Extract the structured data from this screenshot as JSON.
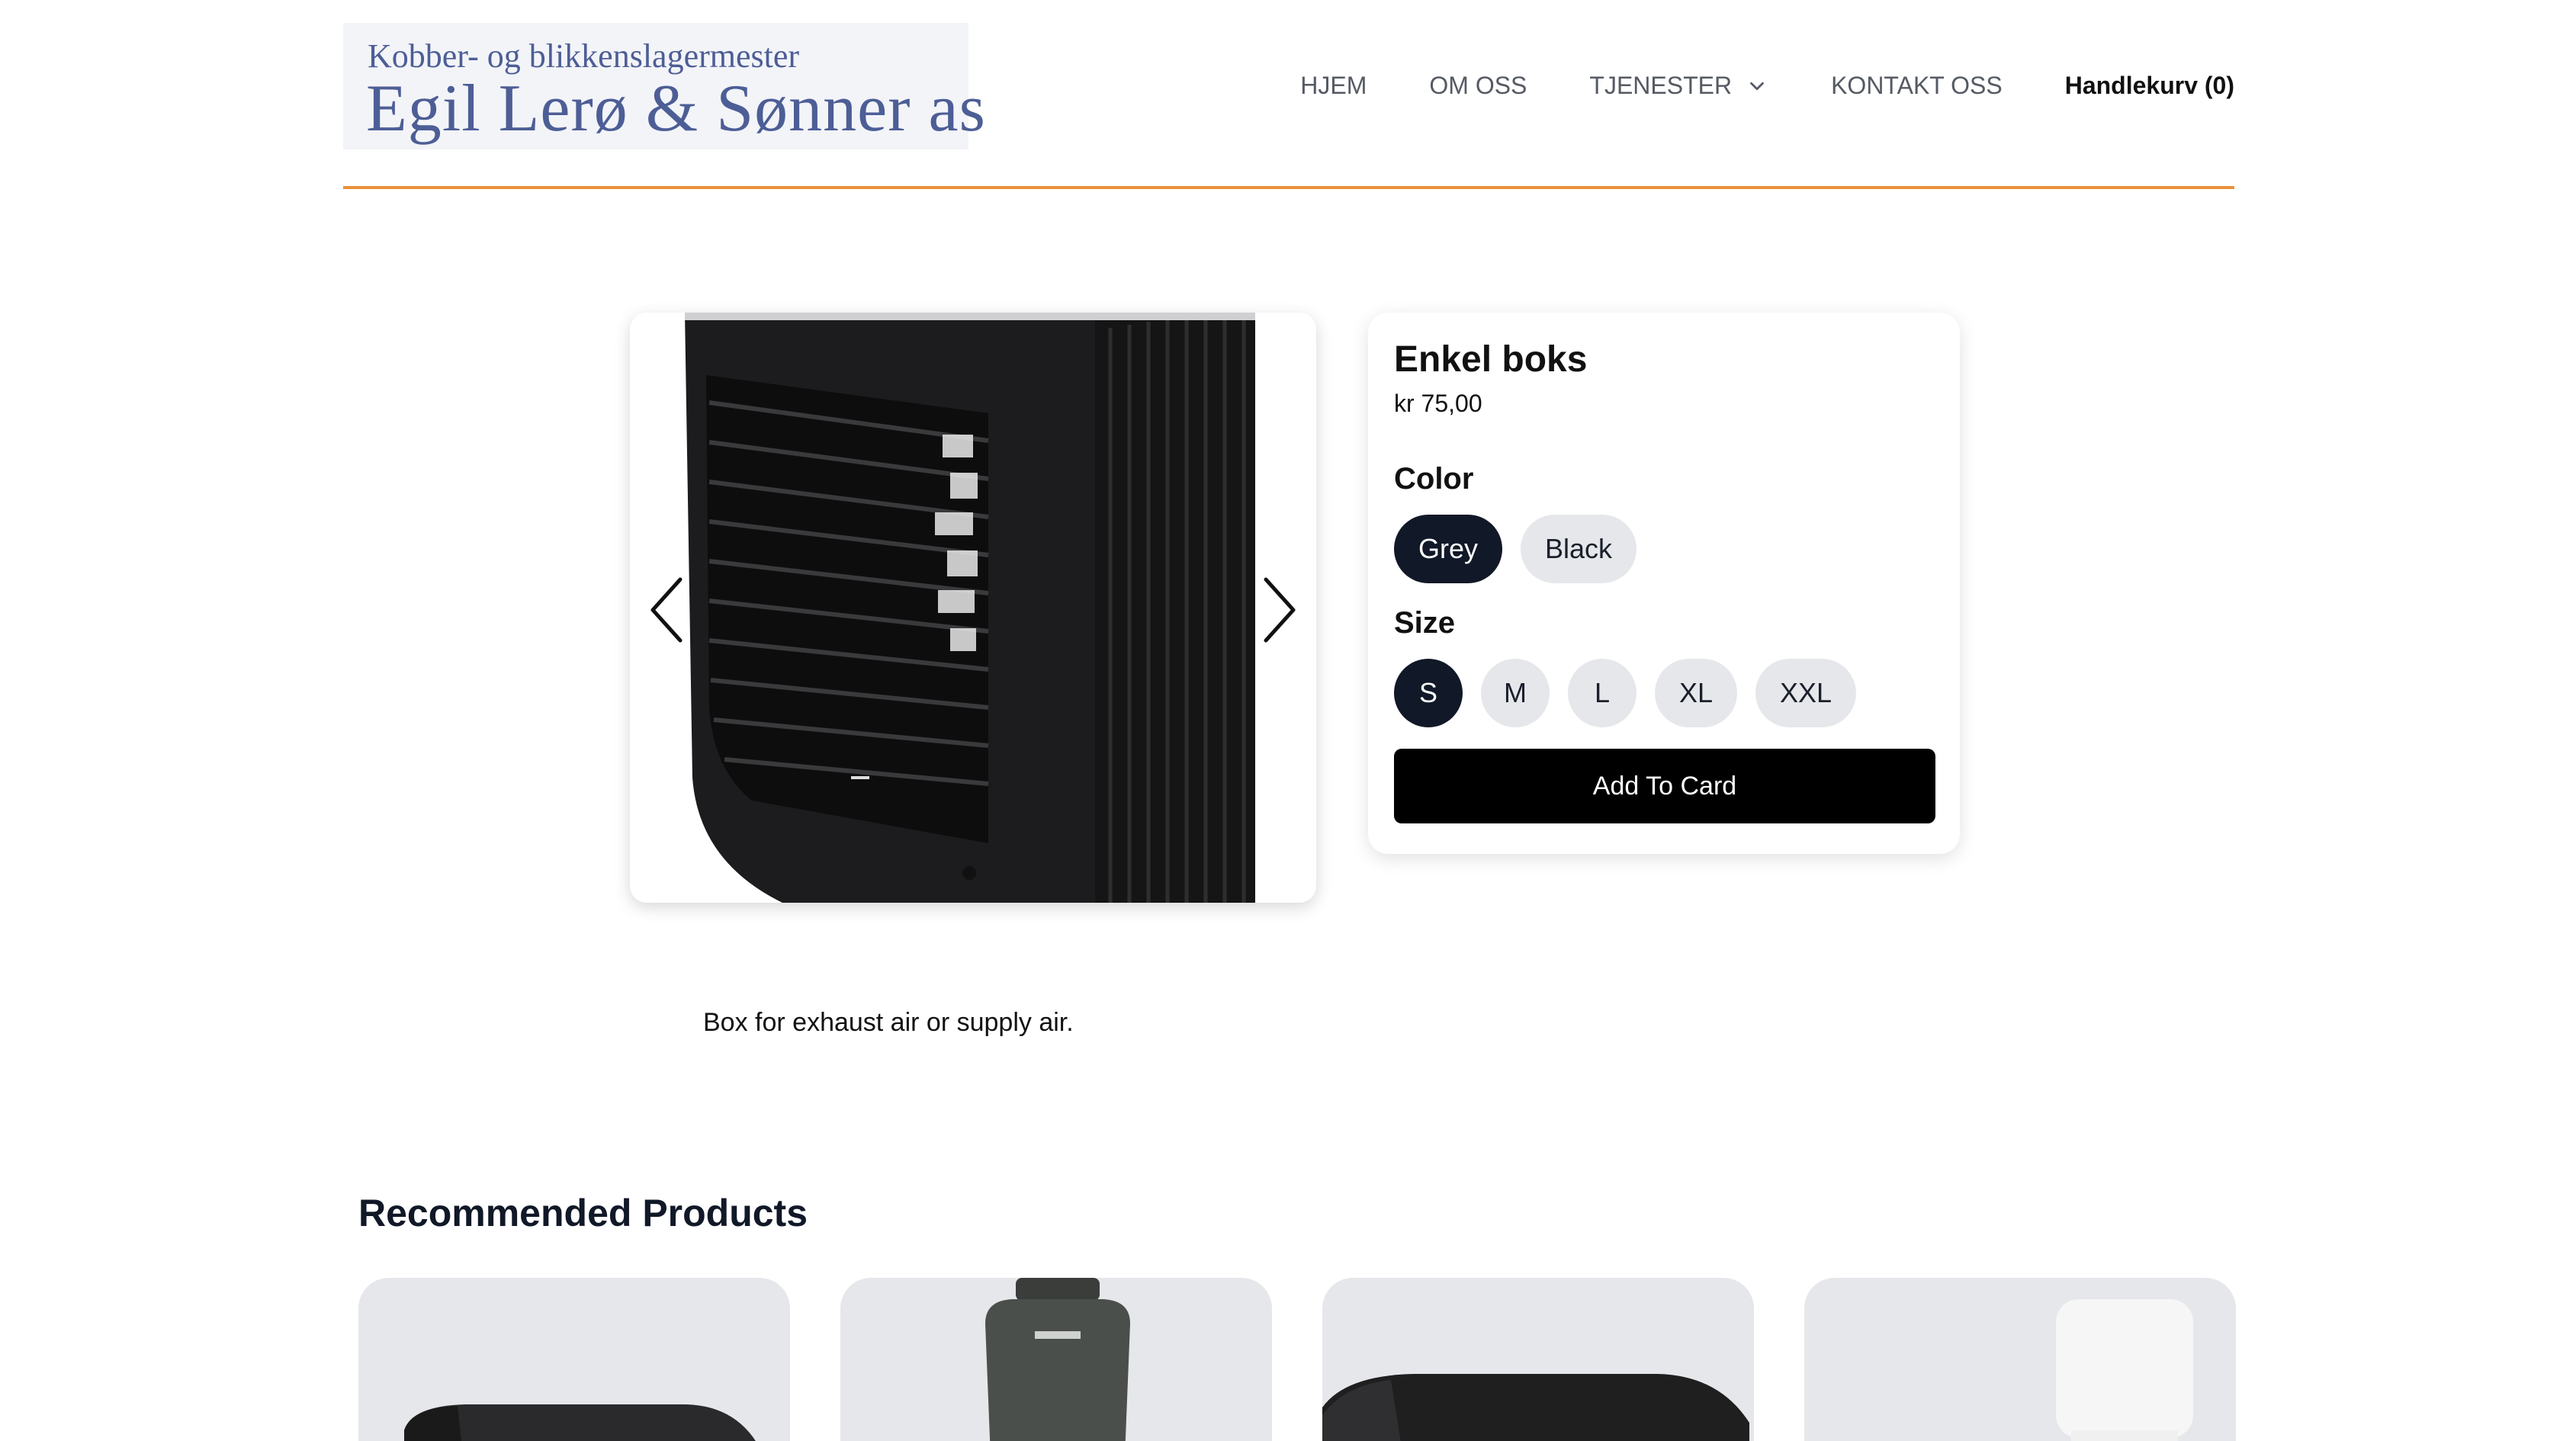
{
  "header": {
    "logo_line1": "Kobber- og blikkenslagermester",
    "logo_line2": "Egil Lerø & Sønner as",
    "nav": {
      "home": "HJEM",
      "about": "OM OSS",
      "services": "TJENESTER",
      "contact": "KONTAKT OSS"
    },
    "cart": "Handlekurv (0)"
  },
  "colors": {
    "accent_line": "#e8913a",
    "selected_option": "#111827",
    "logo_text": "#4d5e96",
    "button": "#000000"
  },
  "icons": {
    "services_dropdown": "chevron-down-icon",
    "carousel_prev": "chevron-left-icon",
    "carousel_next": "chevron-right-icon"
  },
  "product": {
    "title": "Enkel boks",
    "price": "kr 75,00",
    "color_label": "Color",
    "colors": [
      "Grey",
      "Black"
    ],
    "selected_color": "Grey",
    "size_label": "Size",
    "sizes": [
      "S",
      "M",
      "L",
      "XL",
      "XXL"
    ],
    "selected_size": "S",
    "add_button": "Add To Card",
    "description": "Box for exhaust air or supply air."
  },
  "recommended": {
    "title": "Recommended Products"
  }
}
